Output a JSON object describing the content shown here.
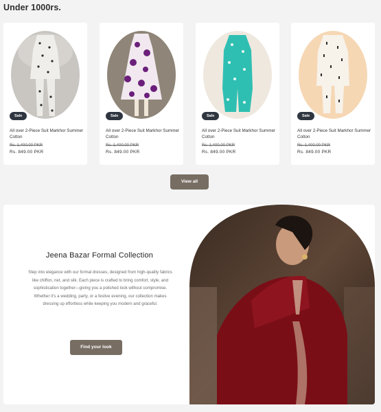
{
  "section": {
    "heading": "Under 1000rs."
  },
  "products": [
    {
      "badge": "Sale",
      "title": "All over 2-Piece Suit Markhor Summer Cotton",
      "old_price": "Rs. 1,400.00 PKR",
      "price": "Rs. 849.00 PKR"
    },
    {
      "badge": "Sale",
      "title": "All over 2-Piece Suit Markhor Summer Cotton",
      "old_price": "Rs. 1,400.00 PKR",
      "price": "Rs. 849.00 PKR"
    },
    {
      "badge": "Sale",
      "title": "All over 2-Piece Suit Markhor Summer Cotton",
      "old_price": "Rs. 1,400.00 PKR",
      "price": "Rs. 849.00 PKR"
    },
    {
      "badge": "Sale",
      "title": "All over 2-Piece Suit Markhor Summer Cotton",
      "old_price": "Rs. 1,400.00 PKR",
      "price": "Rs. 849.00 PKR"
    }
  ],
  "actions": {
    "view_all": "View all"
  },
  "promo": {
    "title": "Jeena Bazar Formal Collection",
    "body": "Step into elegance with our formal dresses, designed from high-quality fabrics like chiffon, net, and silk. Each piece is crafted to bring comfort, style, and sophistication together—giving you a polished look without compromise. Whether it's a wedding, party, or a festive evening, our collection makes dressing up effortless while keeping you modern and graceful.",
    "button": "Find your look"
  },
  "colors": {
    "button": "#776d63",
    "badge": "#2f3640",
    "background": "#f3f3f3"
  }
}
